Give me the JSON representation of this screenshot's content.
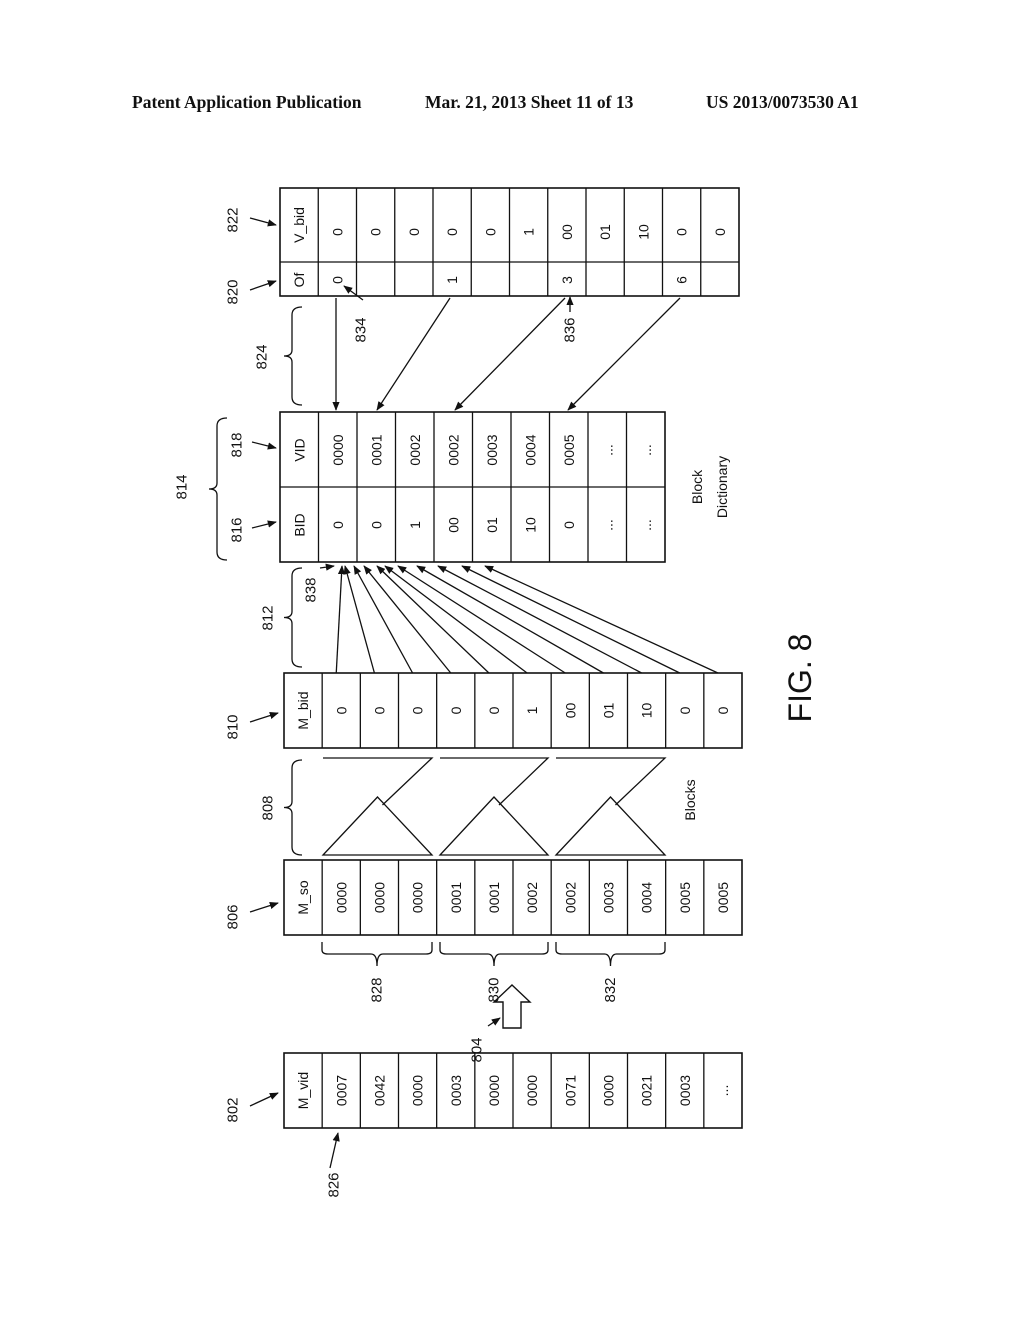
{
  "header": {
    "left": "Patent Application Publication",
    "middle": "Mar. 21, 2013  Sheet 11 of 13",
    "right": "US 2013/0073530 A1"
  },
  "figure_label": "FIG. 8",
  "tables": {
    "m_vid": {
      "ref": "802",
      "header": "M_vid",
      "cells": [
        "0007",
        "0042",
        "0000",
        "0003",
        "0000",
        "0000",
        "0071",
        "0000",
        "0021",
        "0003",
        "..."
      ]
    },
    "m_so": {
      "ref": "806",
      "header": "M_so",
      "cells": [
        "0000",
        "0000",
        "0000",
        "0001",
        "0001",
        "0002",
        "0002",
        "0003",
        "0004",
        "0005",
        "0005"
      ]
    },
    "m_bid": {
      "ref": "810",
      "header": "M_bid",
      "cells": [
        "0",
        "0",
        "0",
        "0",
        "0",
        "1",
        "00",
        "01",
        "10",
        "0",
        "0"
      ]
    },
    "block_dictionary": {
      "ref": "814",
      "caption_line1": "Block",
      "caption_line2": "Dictionary",
      "bid": {
        "ref": "816",
        "header": "BID",
        "cells": [
          "0",
          "0",
          "1",
          "00",
          "01",
          "10",
          "0",
          "...",
          "..."
        ]
      },
      "vid": {
        "ref": "818",
        "header": "VID",
        "cells": [
          "0000",
          "0001",
          "0002",
          "0002",
          "0003",
          "0004",
          "0005",
          "...",
          "..."
        ]
      }
    },
    "of": {
      "ref": "820",
      "header": "Of",
      "cells": [
        "0",
        "",
        "",
        "1",
        "",
        "",
        "3",
        "",
        "",
        "6",
        ""
      ]
    },
    "v_bid": {
      "ref": "822",
      "header": "V_bid",
      "cells": [
        "0",
        "0",
        "0",
        "0",
        "0",
        "1",
        "00",
        "01",
        "10",
        "0",
        "0"
      ]
    }
  },
  "annotations": {
    "sort_arrow_ref": "804",
    "blocks_brace_ref": "808",
    "blocks_label": "Blocks",
    "mbid_brace_ref": "812",
    "of_brace_ref": "824",
    "mvid_pointer_ref": "826",
    "group_refs": [
      "828",
      "830",
      "832"
    ],
    "of_pointer_ref": "834",
    "of_pointer_ref_2": "836",
    "bid_pointer_ref": "838"
  }
}
